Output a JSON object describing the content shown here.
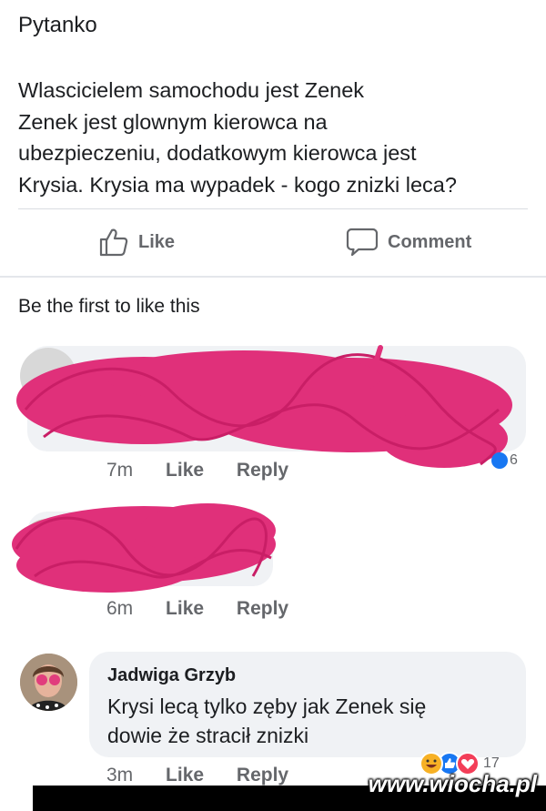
{
  "post": {
    "author": "Pytanko",
    "lines": [
      "Wlascicielem samochodu jest Zenek",
      "Zenek jest glownym kierowca na",
      "ubezpieczeniu, dodatkowym kierowca jest",
      "Krysia. Krysia ma wypadek - kogo znizki leca?"
    ]
  },
  "actions": {
    "like_label": "Like",
    "comment_label": "Comment"
  },
  "likes_text": "Be the first to like this",
  "comments": [
    {
      "time": "7m",
      "like": "Like",
      "reply": "Reply",
      "reaction_count": "6",
      "redacted": true
    },
    {
      "time": "6m",
      "like": "Like",
      "reply": "Reply",
      "redacted": true
    },
    {
      "name": "Jadwiga Grzyb",
      "text_lines": [
        "Krysi lecą tylko zęby jak Zenek się",
        "dowie że stracił znizki"
      ],
      "time": "3m",
      "like": "Like",
      "reply": "Reply",
      "reaction_count": "17",
      "reactions": [
        "haha-icon",
        "like-icon",
        "love-icon"
      ]
    }
  ],
  "watermark": "www.wiocha.pl",
  "colors": {
    "scribble": "#e0307a",
    "like_blue": "#1877f2",
    "love_red": "#f33e58",
    "haha_yellow": "#f7b125",
    "meta_gray": "#65676b"
  }
}
